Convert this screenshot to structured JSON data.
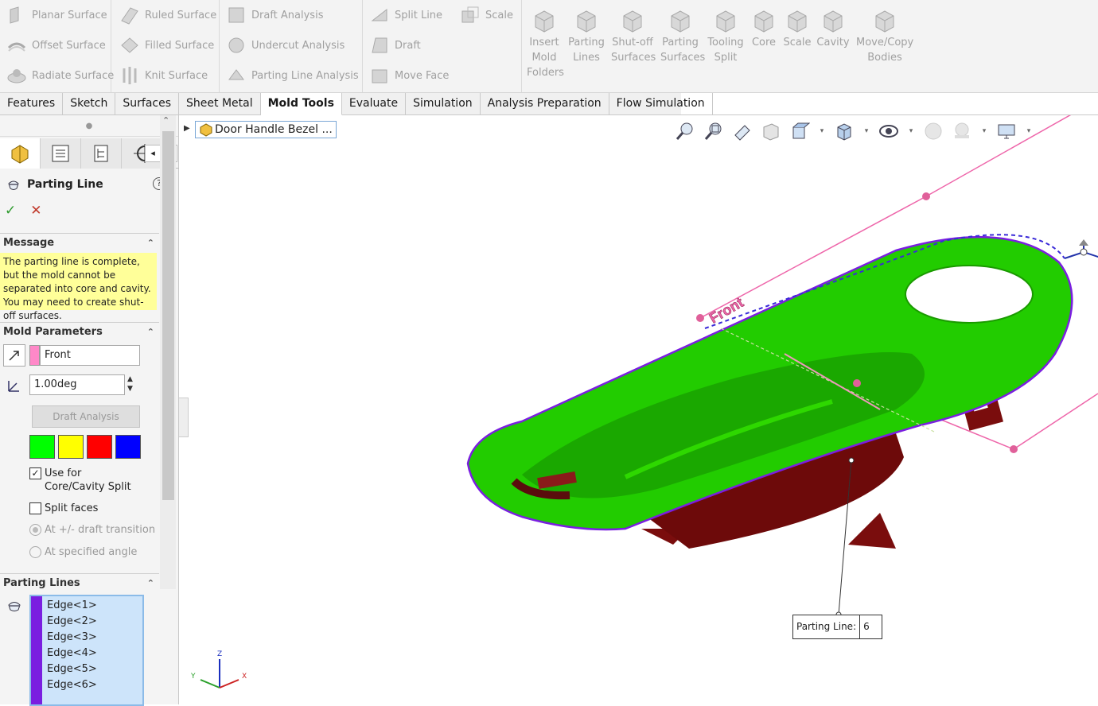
{
  "ribbon": {
    "group1": [
      "Planar Surface",
      "Offset Surface",
      "Radiate Surface"
    ],
    "group2": [
      "Ruled Surface",
      "Filled Surface",
      "Knit Surface"
    ],
    "group3": [
      "Draft Analysis",
      "Undercut Analysis",
      "Parting Line Analysis"
    ],
    "group4": [
      "Split Line",
      "Draft",
      "Move Face"
    ],
    "group4b": [
      "Scale"
    ],
    "large": [
      {
        "l1": "Insert",
        "l2": "Mold",
        "l3": "Folders"
      },
      {
        "l1": "Parting",
        "l2": "Lines",
        "l3": ""
      },
      {
        "l1": "Shut-off",
        "l2": "Surfaces",
        "l3": ""
      },
      {
        "l1": "Parting",
        "l2": "Surfaces",
        "l3": ""
      },
      {
        "l1": "Tooling",
        "l2": "Split",
        "l3": ""
      },
      {
        "l1": "Core",
        "l2": "",
        "l3": ""
      },
      {
        "l1": "Scale",
        "l2": "",
        "l3": ""
      },
      {
        "l1": "Cavity",
        "l2": "",
        "l3": ""
      },
      {
        "l1": "Move/Copy",
        "l2": "Bodies",
        "l3": ""
      }
    ]
  },
  "tabs": [
    "Features",
    "Sketch",
    "Surfaces",
    "Sheet Metal",
    "Mold Tools",
    "Evaluate",
    "Simulation",
    "Analysis Preparation",
    "Flow Simulation"
  ],
  "active_tab": "Mold Tools",
  "property_manager": {
    "title": "Parting Line",
    "help": "?",
    "ok": "✓",
    "cancel": "✕",
    "message_header": "Message",
    "message": "The parting line is complete, but the mold cannot be separated into core and cavity. You may need to create shut-off surfaces.",
    "mold_params_header": "Mold Parameters",
    "direction_value": "Front",
    "draft_angle": "1.00deg",
    "draft_analysis_button": "Draft Analysis",
    "colors": [
      "#00ff00",
      "#ffff00",
      "#ff0000",
      "#0000ff"
    ],
    "use_for_split_l1": "Use for",
    "use_for_split_l2": "Core/Cavity Split",
    "use_for_split_checked": "✓",
    "split_faces": "Split faces",
    "radio1": "At +/- draft transition",
    "radio2": "At specified angle",
    "parting_lines_header": "Parting Lines",
    "edges": [
      "Edge<1>",
      "Edge<2>",
      "Edge<3>",
      "Edge<4>",
      "Edge<5>",
      "Edge<6>"
    ]
  },
  "tree": {
    "part_name": "Door Handle Bezel ..."
  },
  "viewport": {
    "plane_label": "Front",
    "parting_line_label": "Parting Line:",
    "parting_line_count": "6",
    "triad": {
      "x": "X",
      "y": "Y",
      "z": "Z"
    },
    "colors": {
      "green": "#22cc00",
      "maroon": "#7a0d0d",
      "purple": "#7a1ee0",
      "pink": "#ee66aa"
    }
  }
}
